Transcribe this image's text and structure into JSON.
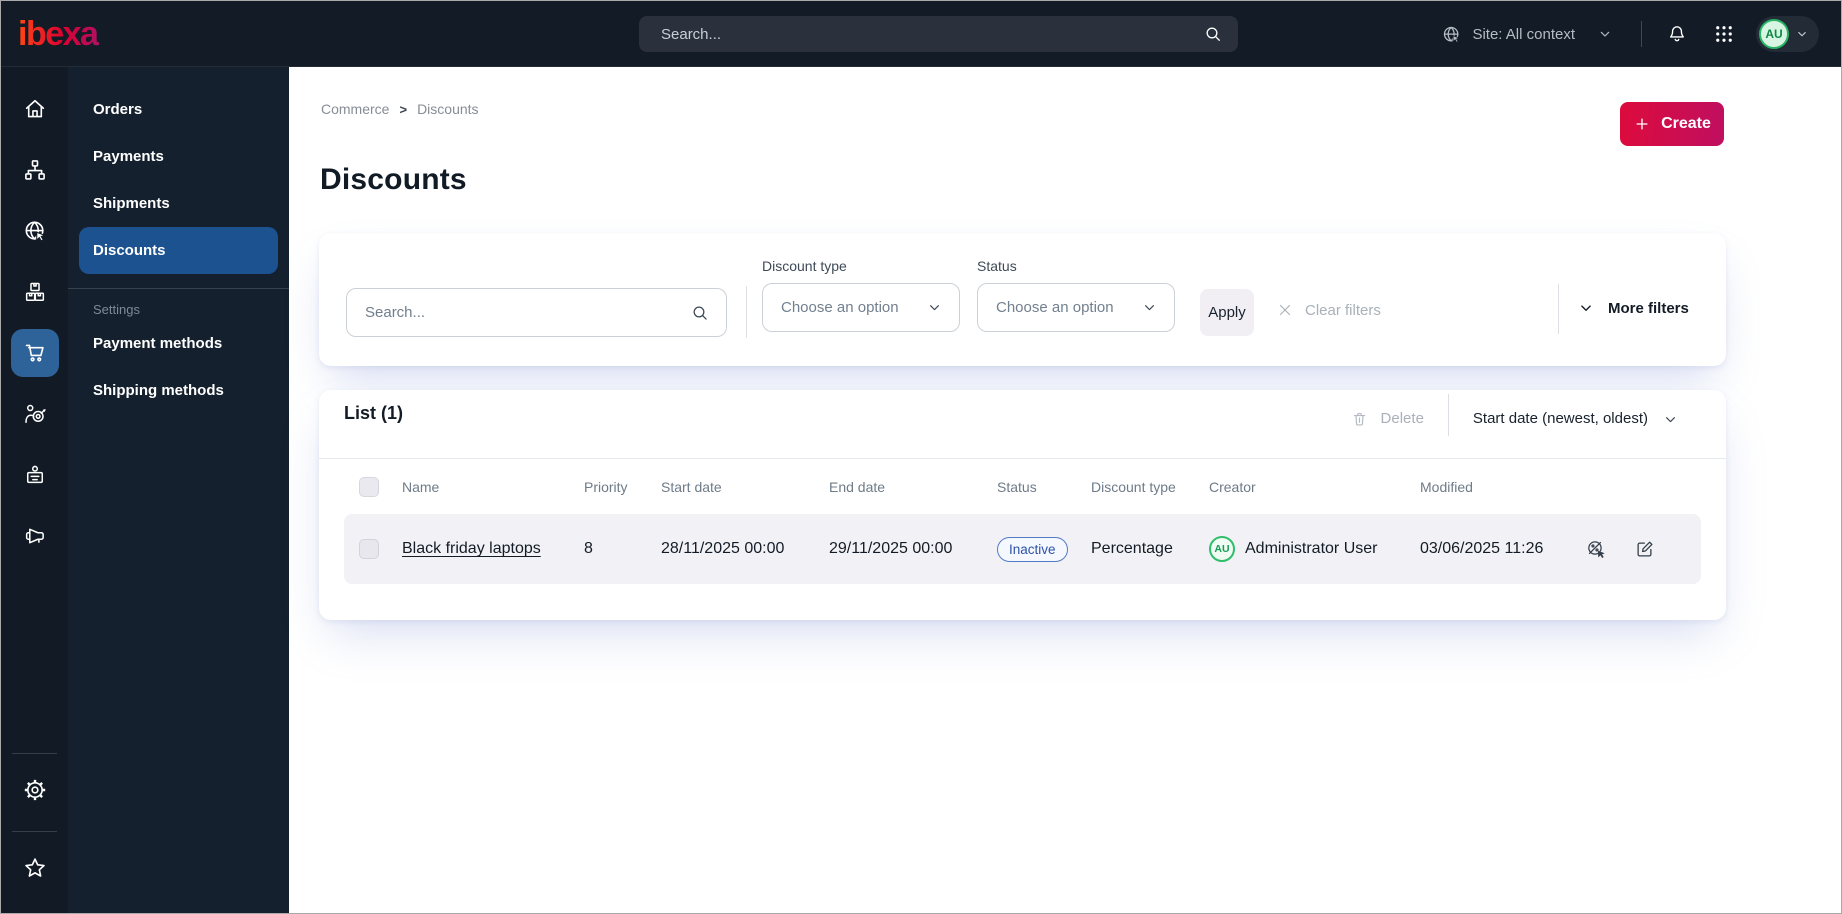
{
  "topbar": {
    "logo_text": "ibexa",
    "search_placeholder": "Search...",
    "site_context": "Site: All context",
    "avatar_initials": "AU"
  },
  "icons": {
    "topbar": [
      "search-icon",
      "site-globe-icon",
      "chevron-down-icon",
      "bell-icon",
      "app-grid-icon"
    ],
    "rail": [
      "home-icon",
      "sitemap-icon",
      "site-cursor-globe-icon",
      "products-boxes-icon",
      "commerce-cart-icon",
      "personalization-target-icon",
      "corporate-badge-icon",
      "marketing-megaphone-icon",
      "settings-gear-icon",
      "bookmarks-star-icon"
    ],
    "content": [
      "plus-icon",
      "search-icon",
      "chevron-down-icon",
      "close-icon",
      "trash-icon",
      "discount-disable-icon",
      "edit-icon"
    ]
  },
  "rail": {
    "active_item": "commerce-cart"
  },
  "menu": {
    "items": [
      "Orders",
      "Payments",
      "Shipments",
      "Discounts"
    ],
    "active_item": "Discounts",
    "section_label": "Settings",
    "settings_items": [
      "Payment methods",
      "Shipping methods"
    ]
  },
  "breadcrumb": {
    "items": [
      "Commerce",
      "Discounts"
    ],
    "separator": ">"
  },
  "page": {
    "title": "Discounts"
  },
  "actions": {
    "create_label": "Create"
  },
  "filters": {
    "search_placeholder": "Search...",
    "discount_type_label": "Discount type",
    "discount_type_value": "Choose an option",
    "status_label": "Status",
    "status_value": "Choose an option",
    "apply_label": "Apply",
    "clear_label": "Clear filters",
    "more_label": "More filters"
  },
  "list": {
    "title": "List (1)",
    "delete_label": "Delete",
    "sort_label": "Start date (newest, oldest)",
    "columns": [
      "Name",
      "Priority",
      "Start date",
      "End date",
      "Status",
      "Discount type",
      "Creator",
      "Modified"
    ],
    "rows": [
      {
        "name": "Black friday laptops",
        "priority": "8",
        "start_date": "28/11/2025 00:00",
        "end_date": "29/11/2025 00:00",
        "status": "Inactive",
        "discount_type": "Percentage",
        "creator_initials": "AU",
        "creator": "Administrator User",
        "modified": "03/06/2025 11:26"
      }
    ]
  },
  "colors": {
    "topbar_bg": "#131b26",
    "submenu_bg": "#14202d",
    "brand_gradient": [
      "#ff4713",
      "#db0032",
      "#ae1164"
    ],
    "create_gradient": [
      "#dd0b3c",
      "#bf0f60"
    ],
    "rail_active_blue": "#2e639a",
    "menu_active_blue": "#1d5291",
    "status_badge_blue": "#2c52a8",
    "avatar_green": "#27b363",
    "row_bg": "#f2f2f6"
  }
}
